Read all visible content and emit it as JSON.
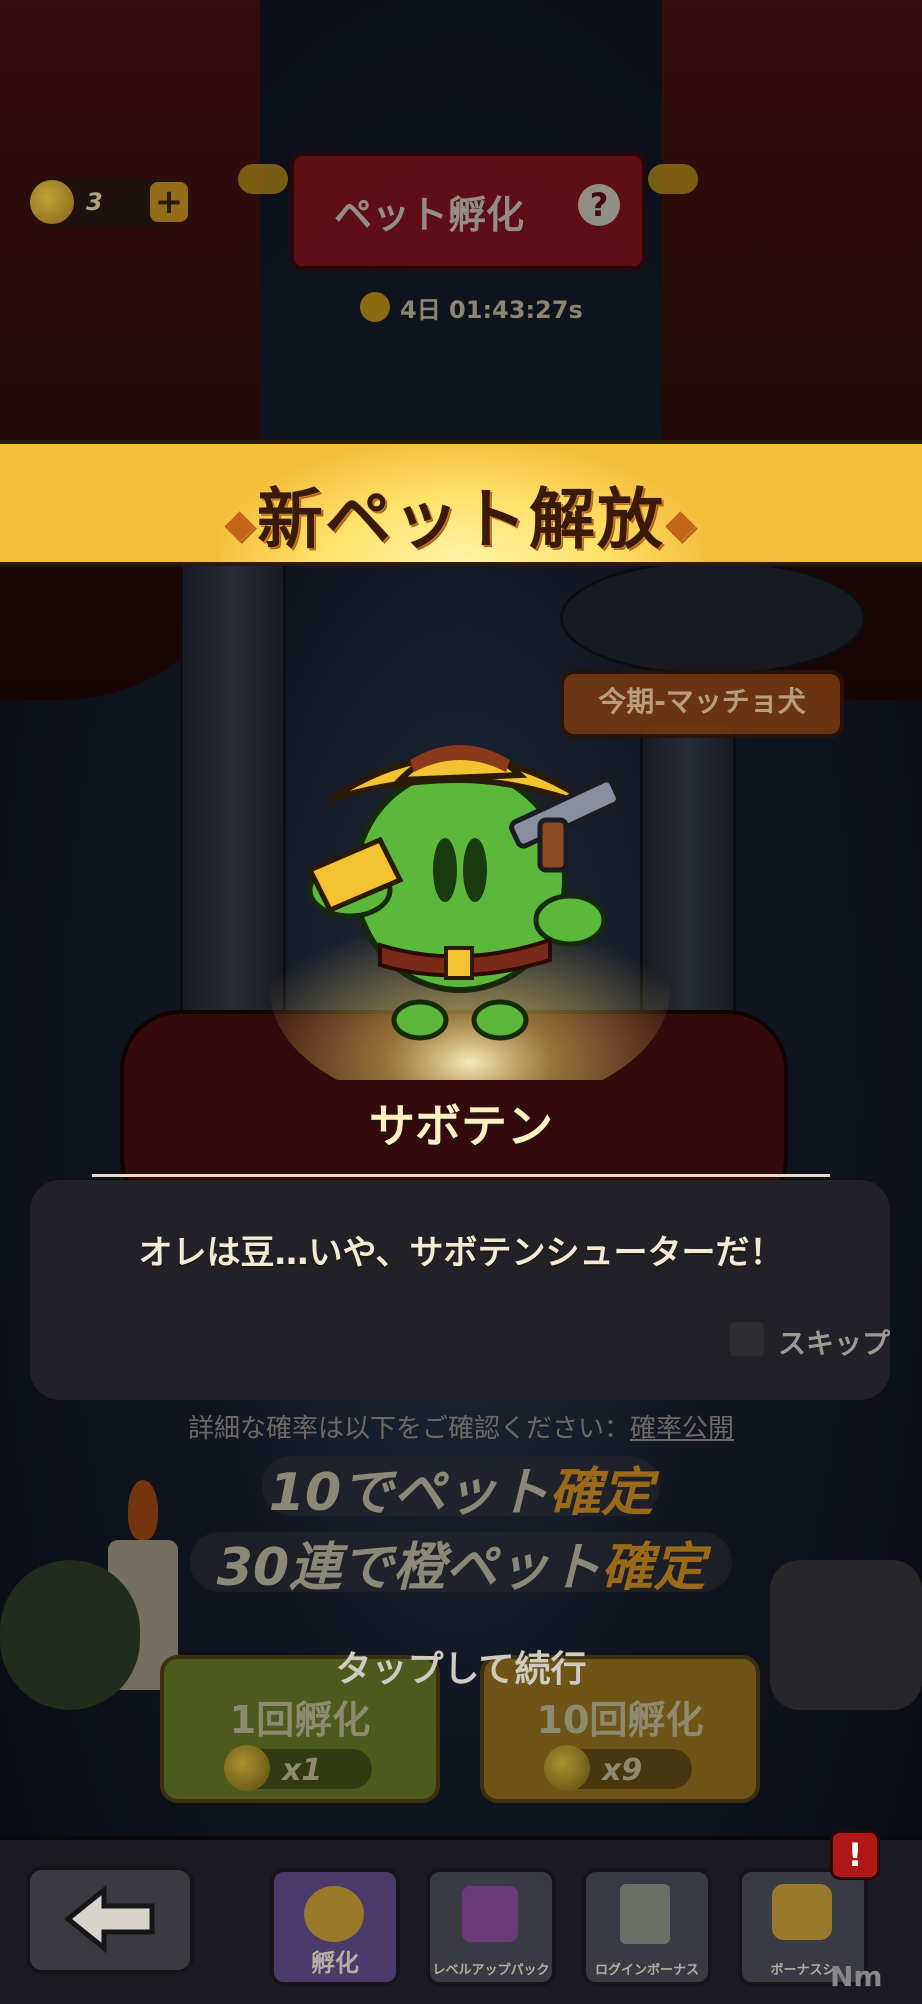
{
  "top": {
    "currency_count": "3",
    "plus_label": "+",
    "title": "ペット孵化",
    "help_label": "?",
    "timer": "4日 01:43:27s"
  },
  "banner": {
    "title": "新ペット解放"
  },
  "season_sign": "今期-マッチョ犬",
  "pet": {
    "name": "サボテン",
    "description": "オレは豆…いや、サボテンシューターだ！"
  },
  "skip_label": "スキップ",
  "probability": {
    "text": "詳細な確率は以下をご確認ください：",
    "link": "確率公開"
  },
  "guarantee": {
    "line1_num": "10",
    "line1_mid": "でペット",
    "line1_hi": "確定",
    "line2_num": "30",
    "line2_mid": "連で橙ペット",
    "line2_hi": "確定"
  },
  "tap_to_continue": "タップして続行",
  "hatch_buttons": [
    {
      "label": "1回孵化",
      "cost": "x1"
    },
    {
      "label": "10回孵化",
      "cost": "x9"
    }
  ],
  "nav": {
    "items": [
      {
        "label": "孵化"
      },
      {
        "label": "レベルアップパック"
      },
      {
        "label": "ログインボーナス"
      },
      {
        "label": "ボーナスシ"
      }
    ],
    "badge": "!"
  },
  "watermark": "Nm",
  "colors": {
    "banner_yellow": "#f4bd3a",
    "pet_green": "#5bb83a",
    "hat_yellow": "#f2c230"
  }
}
